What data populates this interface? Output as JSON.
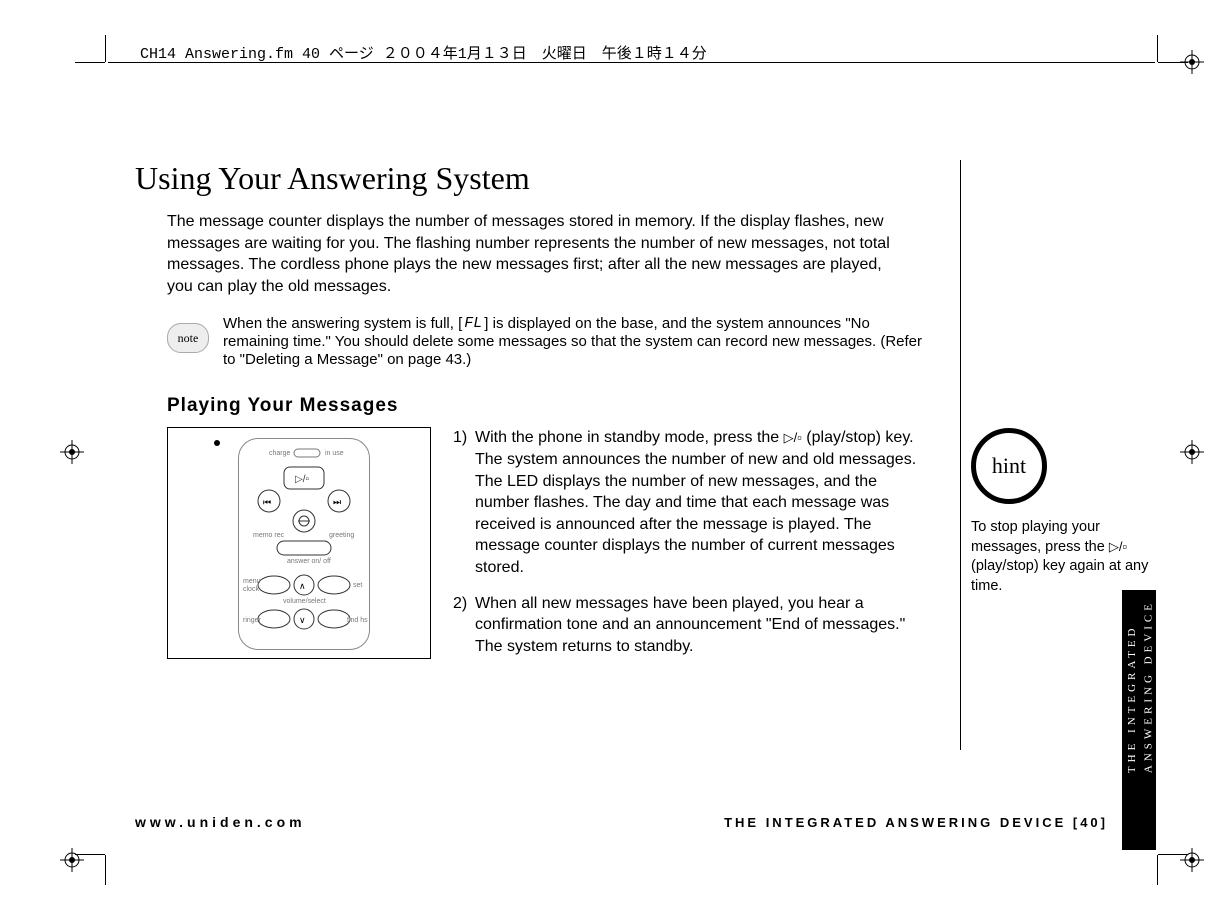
{
  "header_line": "CH14 Answering.fm  40 ページ  ２００４年1月１３日　火曜日　午後１時１４分",
  "title": "Using Your Answering System",
  "intro": "The message counter displays the number of messages stored in memory. If the display flashes, new messages are waiting for you. The flashing number represents the number of new messages, not total messages. The cordless phone plays the new messages first; after all the new messages are played, you can play the old messages.",
  "note": {
    "badge": "note",
    "pre": "When the answering system is full, [",
    "symbol": "FL",
    "post": "] is displayed on the base, and the system announces \"No remaining time.\" You should delete some messages so that the system can record new messages. (Refer to \"Deleting a Message\" on page 43.)"
  },
  "subhead": "Playing Your Messages",
  "illus_labels": {
    "charge": "charge",
    "in_use": "in use",
    "memo_rec": "memo rec",
    "greeting": "greeting",
    "answer": "answer on/ off",
    "menu_clock": "menu\nclock",
    "set": "set",
    "volume": "volume/select",
    "ringer": "ringer",
    "find_hs": "find hs"
  },
  "steps": [
    {
      "num": "1)",
      "pre": "With the phone in standby mode, press the ",
      "icon": "▷/▫",
      "post": " (play/stop) key. The system announces the number of new and old messages. The LED displays the number of new messages, and the number flashes. The day and time that each message was received is announced after the message is played. The message counter displays the number of current messages stored."
    },
    {
      "num": "2)",
      "pre": "When all new messages have been played, you hear a confirmation tone and an announcement \"End of messages.\" The system returns to standby.",
      "icon": "",
      "post": ""
    }
  ],
  "hint": {
    "badge": "hint",
    "pre": "To stop playing your messages, press the ",
    "icon": "▷/▫",
    "post": " (play/stop) key again at any time."
  },
  "tab_text": "THE INTEGRATED\nANSWERING DEVICE",
  "footer_left": "www.uniden.com",
  "footer_right": "THE INTEGRATED ANSWERING DEVICE [40]"
}
